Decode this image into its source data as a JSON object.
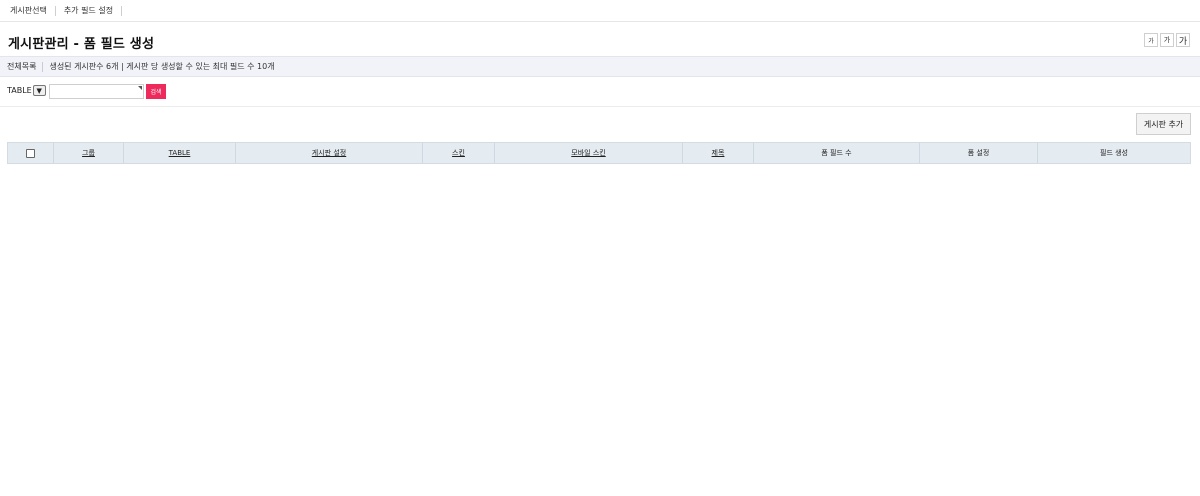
{
  "topnav": {
    "items": [
      "게시판선택",
      "추가 필드 설정"
    ]
  },
  "header": {
    "title": "게시판관리 - 폼 필드 생성",
    "font_sizes": [
      "가",
      "가",
      "가"
    ]
  },
  "infobar": {
    "all_list": "전체목록",
    "summary": "생성된 게시판수 6개 | 게시판 당 생성할 수 있는 최대 필드 수 10개"
  },
  "search": {
    "select_value": "TABLE",
    "select_arrow": "▼",
    "input_value": "",
    "button_label": "검색"
  },
  "actions": {
    "add_board_label": "게시판 추가"
  },
  "table": {
    "columns": [
      "그룹",
      "TABLE",
      "게시판 설정",
      "스킨",
      "모바일 스킨",
      "제목",
      "폼 필드 수",
      "폼 설정",
      "필드 생성"
    ],
    "rows": []
  },
  "colors": {
    "accent": "#ee2a5d",
    "header_bg": "#e4ebf1",
    "infobar_bg": "#f1f3f8"
  }
}
